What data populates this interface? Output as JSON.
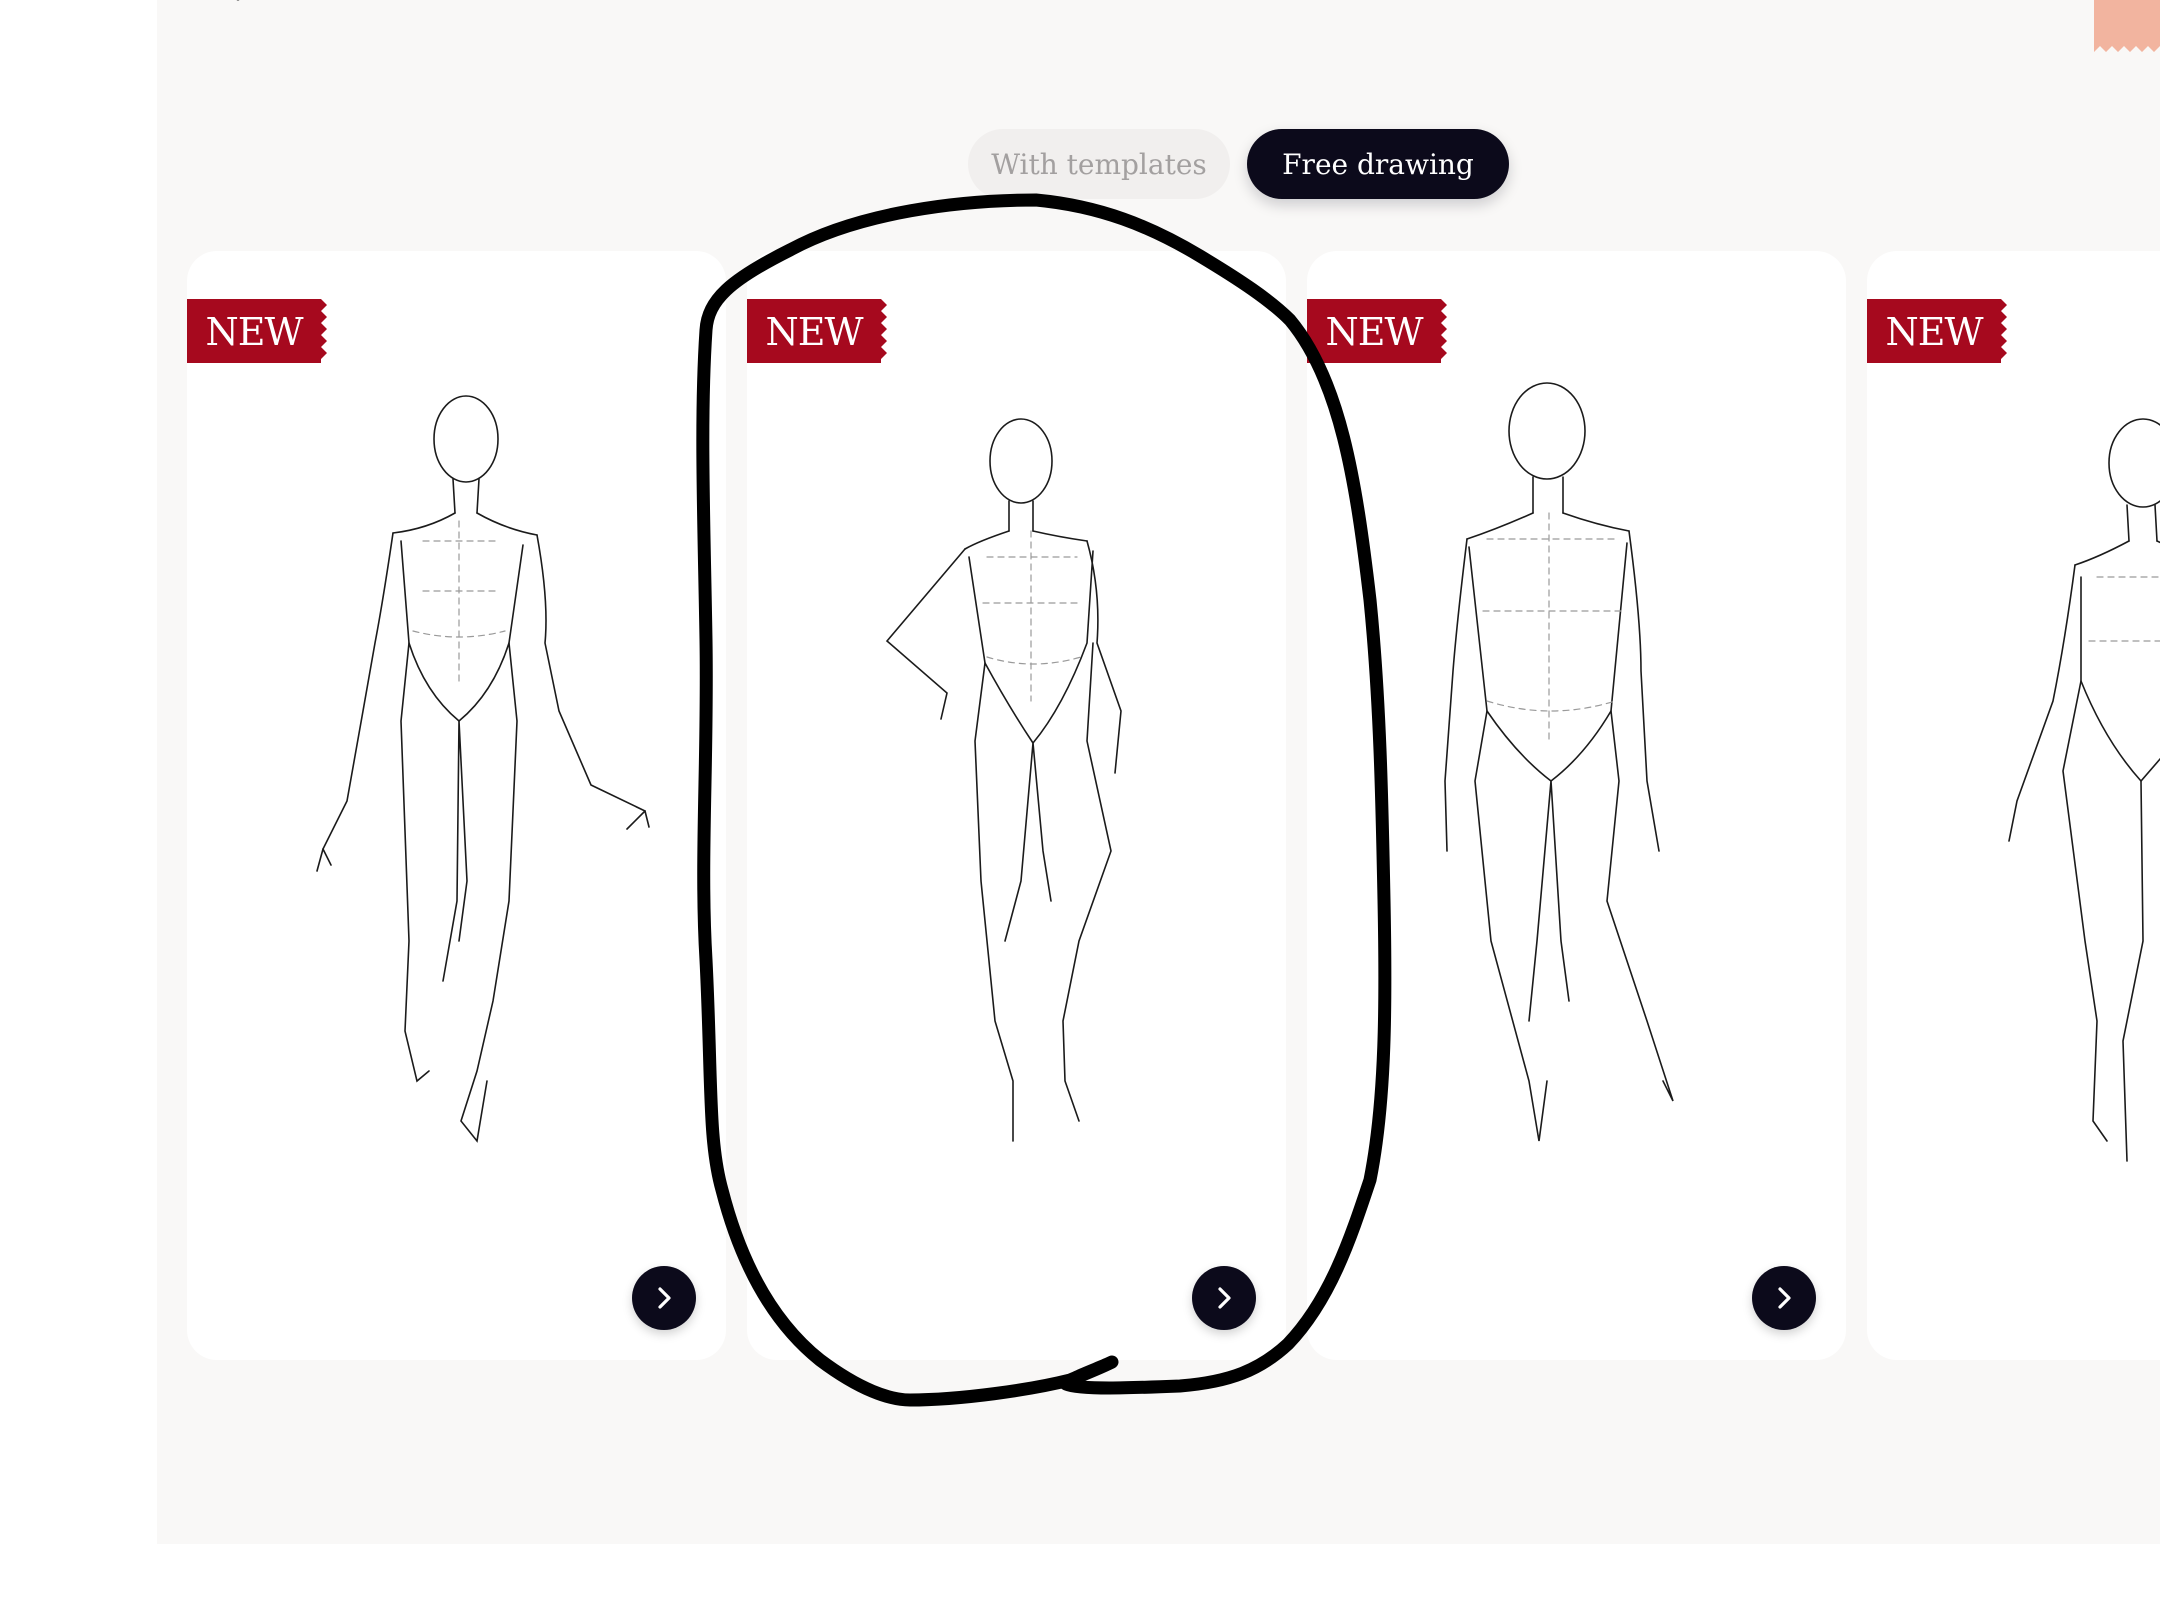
{
  "toggle": {
    "options": [
      "With templates",
      "Free drawing"
    ],
    "selected": "Free drawing"
  },
  "cards": [
    {
      "badge": "NEW",
      "pose": "front-walk",
      "action_icon": "chevron-right-icon"
    },
    {
      "badge": "NEW",
      "pose": "hand-on-hip",
      "action_icon": "chevron-right-icon"
    },
    {
      "badge": "NEW",
      "pose": "front-stand",
      "action_icon": "chevron-right-icon"
    },
    {
      "badge": "NEW",
      "pose": "side-walk",
      "action_icon": "chevron-right-icon"
    }
  ],
  "icons": {
    "back": "back-arrow-icon",
    "corner": "corner-tab-icon"
  },
  "colors": {
    "badge": "#a6091e",
    "accent_dark": "#0c0a1b",
    "panel_background": "#f9f8f7",
    "inactive_toggle_bg": "#f1efee",
    "inactive_toggle_text": "#a3a0a0",
    "corner_tab": "#f2b49f",
    "annotation_stroke": "#000000"
  },
  "annotation": {
    "shape": "hand-drawn-loop",
    "encircles": "card-2"
  }
}
